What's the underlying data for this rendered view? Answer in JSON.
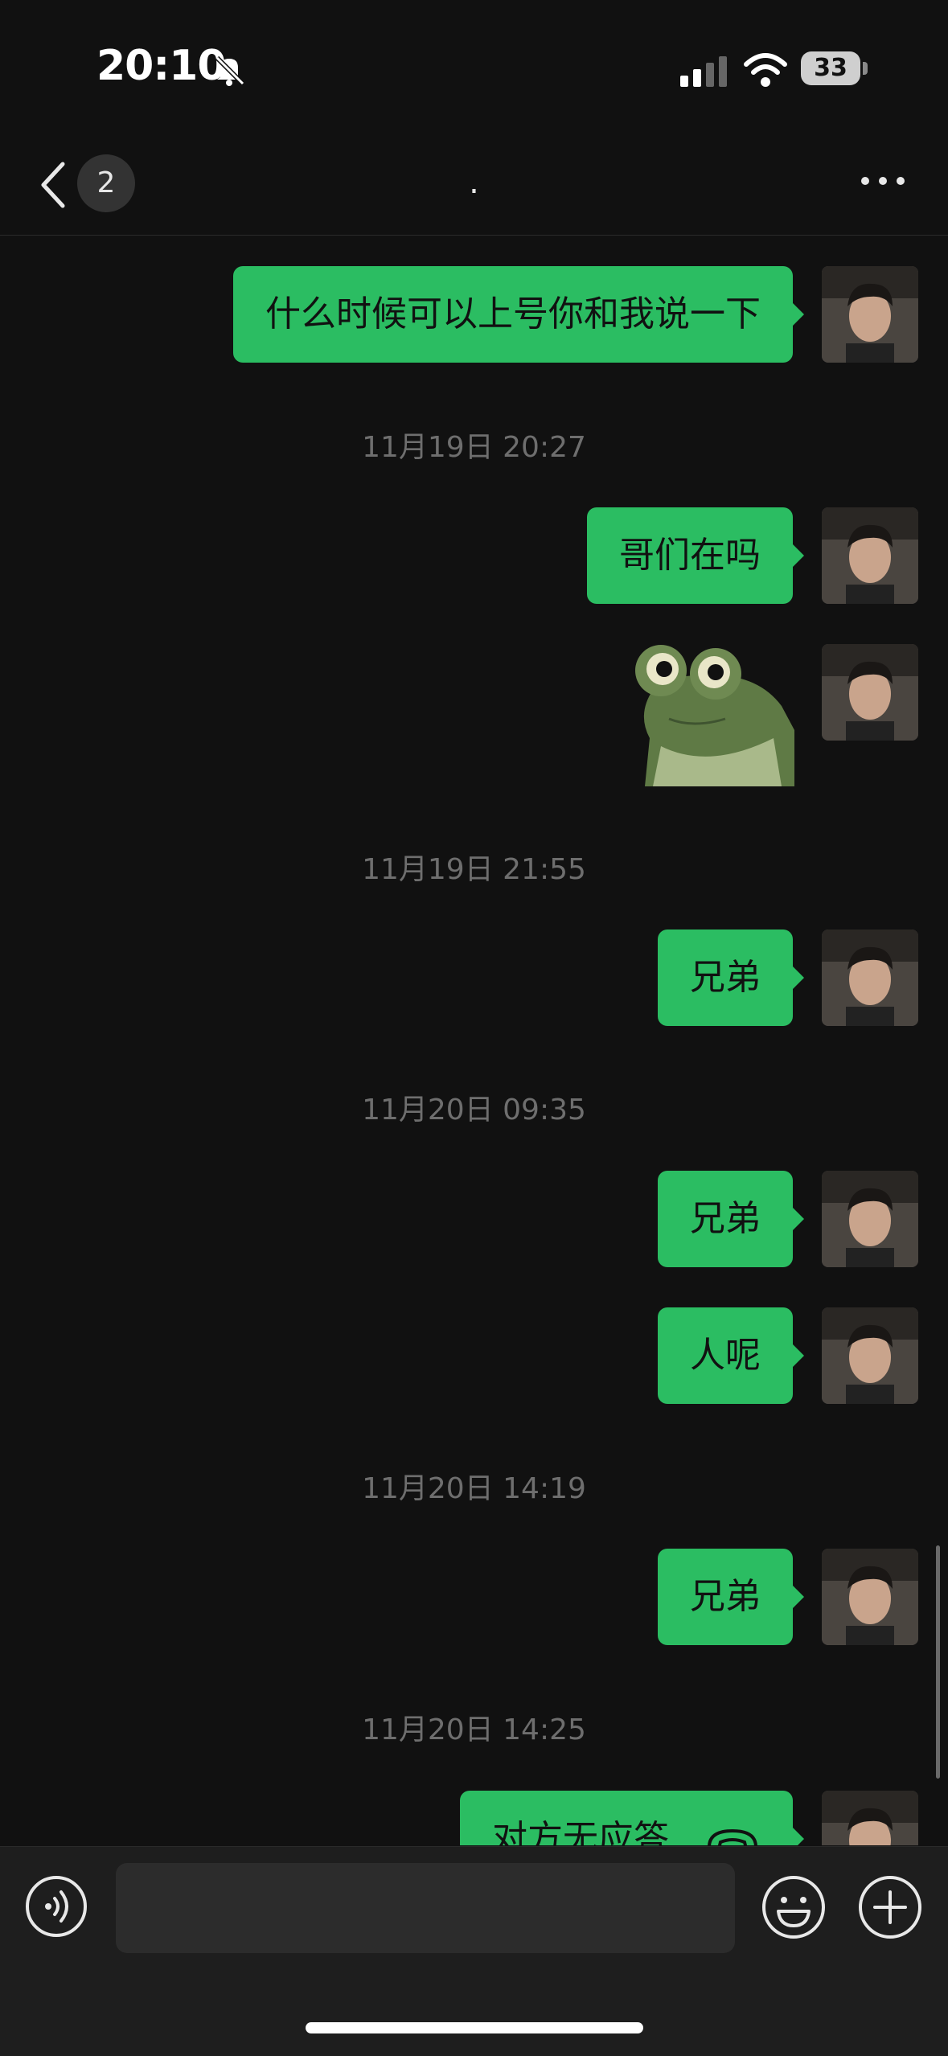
{
  "status_bar": {
    "time": "20:10",
    "battery": "33"
  },
  "nav": {
    "unread_count": "2",
    "title": "."
  },
  "messages": {
    "m1": "什么时候可以上号你和我说一下",
    "ts1": "11月19日 20:27",
    "m2": "哥们在吗",
    "ts2": "11月19日 21:55",
    "m3": "兄弟",
    "ts3": "11月20日 09:35",
    "m4": "兄弟",
    "m5": "人呢",
    "ts4": "11月20日 14:19",
    "m6": "兄弟",
    "ts5": "11月20日 14:25",
    "m7": "对方无应答"
  },
  "colors": {
    "bubble": "#2bbd62",
    "background": "#111111"
  }
}
